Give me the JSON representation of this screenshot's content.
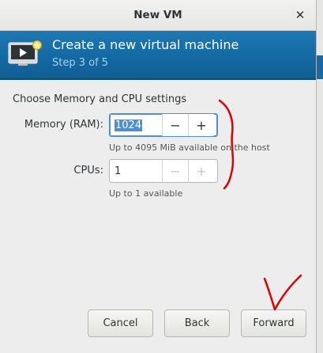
{
  "window": {
    "title": "New VM",
    "close_glyph": "✕"
  },
  "banner": {
    "title": "Create a new virtual machine",
    "step": "Step 3 of 5",
    "icon": "virtual-machine-new-icon"
  },
  "section_title": "Choose Memory and CPU settings",
  "memory": {
    "label": "Memory (RAM):",
    "value": "1024",
    "hint": "Up to 4095 MiB available on the host",
    "decrement": "−",
    "increment": "+"
  },
  "cpus": {
    "label": "CPUs:",
    "value": "1",
    "hint": "Up to 1 available",
    "decrement": "−",
    "increment": "+"
  },
  "buttons": {
    "cancel": "Cancel",
    "back": "Back",
    "forward": "Forward"
  },
  "colors": {
    "banner": "#1d78b4",
    "step_text": "#9ed3f5",
    "focus": "#4a90d9",
    "annotation": "#e00000"
  }
}
